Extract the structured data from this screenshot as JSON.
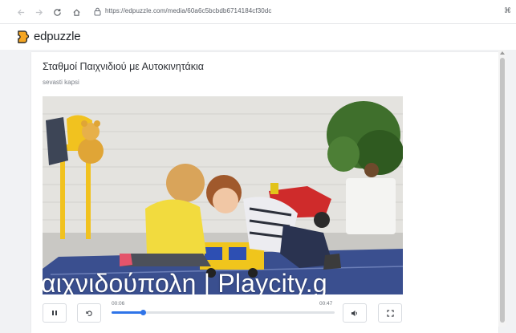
{
  "browser": {
    "url": "https://edpuzzle.com/media/60a6c5bcbdb6714184cf30dc",
    "back_icon": "arrow-left-icon",
    "forward_icon": "arrow-right-icon",
    "reload_icon": "reload-icon",
    "home_icon": "home-icon",
    "extension_glyph": "⌘"
  },
  "site": {
    "brand": "edpuzzle",
    "brand_color": "#f5a623"
  },
  "video": {
    "title": "Σταθμοί Παιχνιδιού με Αυτοκινητάκια",
    "author": "sevasti kapsi",
    "subtitle": "αιχνιδούπολη | Playcity.g"
  },
  "player": {
    "current_time": "00:06",
    "duration": "00:47",
    "progress_percent": 14,
    "accent_color": "#2f74e8",
    "pause_icon": "pause-icon",
    "replay_icon": "replay-icon",
    "volume_icon": "volume-icon",
    "fullscreen_icon": "fullscreen-icon"
  }
}
